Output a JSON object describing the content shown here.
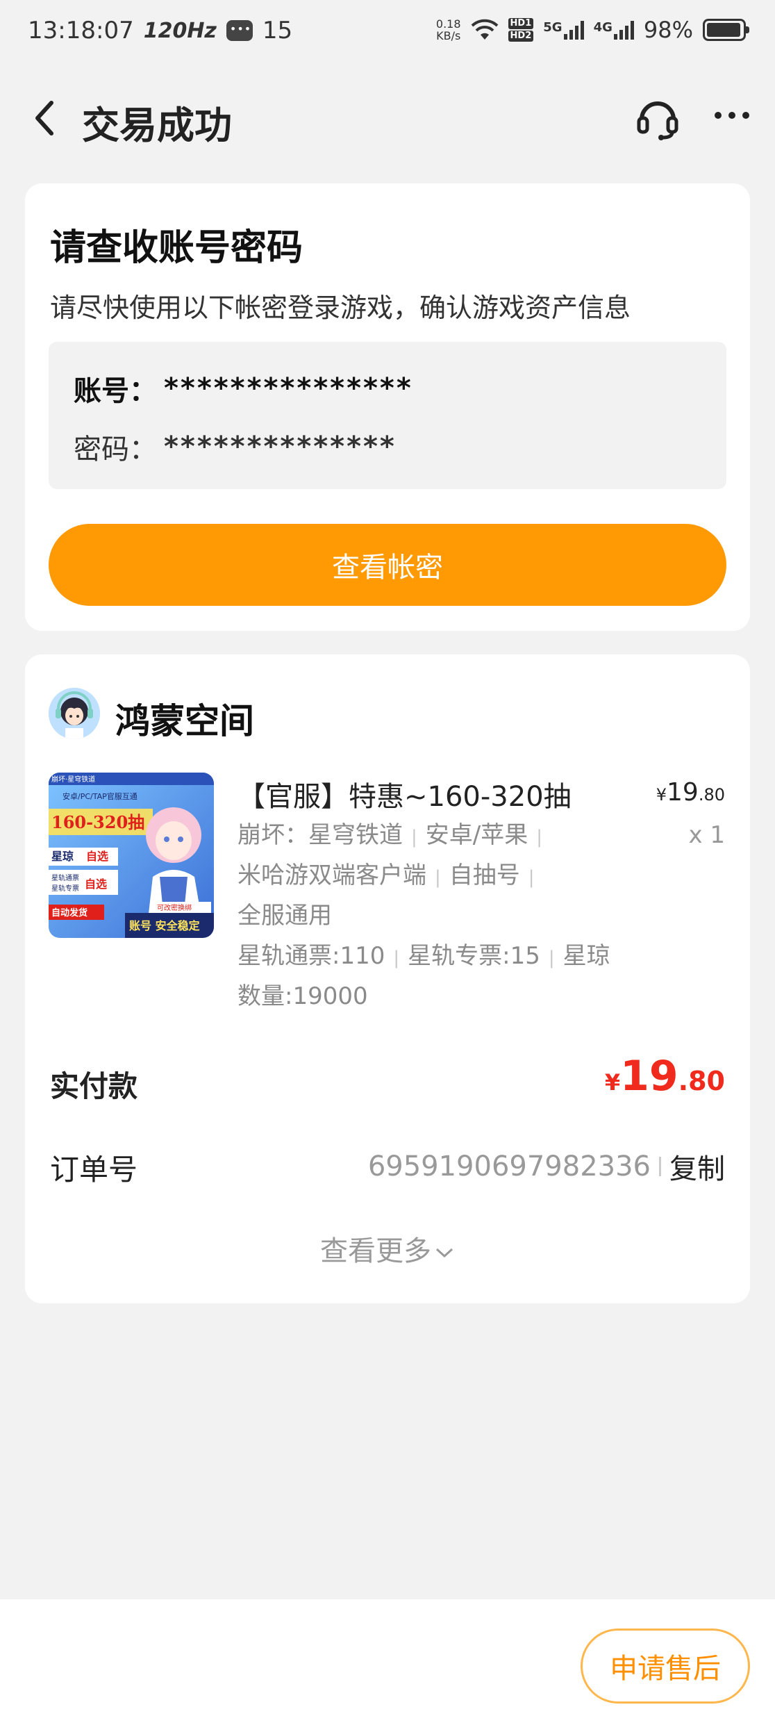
{
  "status_bar": {
    "time": "13:18:07",
    "refresh_rate": "120Hz",
    "notification_count": "15",
    "net_speed_value": "0.18",
    "net_speed_unit": "KB/s",
    "hd1": "HD1",
    "hd2": "HD2",
    "net1": "5G",
    "net2": "4G",
    "battery": "98%"
  },
  "header": {
    "title": "交易成功"
  },
  "credentials": {
    "title": "请查收账号密码",
    "subtitle": "请尽快使用以下帐密登录游戏，确认游戏资产信息",
    "account_label": "账号：",
    "account_value": "***************",
    "password_label": "密码：",
    "password_value": "**************",
    "view_button": "查看帐密"
  },
  "order": {
    "shop_name": "鸿蒙空间",
    "product_title": "【官服】特惠~160-320抽",
    "price_currency": "¥",
    "price_int": "19",
    "price_dec": ".80",
    "quantity": "x 1",
    "attrs": {
      "a1": "崩坏：星穹铁道",
      "a2": "安卓/苹果",
      "a3": "米哈游双端客户端",
      "a4": "自抽号",
      "a5": "全服通用",
      "a6": "星轨通票:110",
      "a7": "星轨专票:15",
      "a8": "星琼",
      "a9": "数量:19000"
    },
    "image_text": {
      "top": "安卓/PC/TAP官服互通",
      "main": "160-320抽",
      "tag1": "星琼",
      "tag1b": "自选",
      "tag2": "星轨通票",
      "tag3": "星轨专票",
      "tag2b": "自选",
      "badge": "自动发货",
      "bottom": "账号 安全稳定",
      "corner": "可改密换绑",
      "brand": "崩坏·星穹铁道"
    },
    "paid_label": "实付款",
    "paid_currency": "¥",
    "paid_int": "19",
    "paid_dec": ".80",
    "order_label": "订单号",
    "order_number": "6959190697982336",
    "copy_label": "复制",
    "more_label": "查看更多"
  },
  "bottom": {
    "after_sale_button": "申请售后"
  },
  "colors": {
    "accent": "#ff9a05",
    "price_red": "#f02a1c",
    "after_sale": "#ff8f00"
  }
}
